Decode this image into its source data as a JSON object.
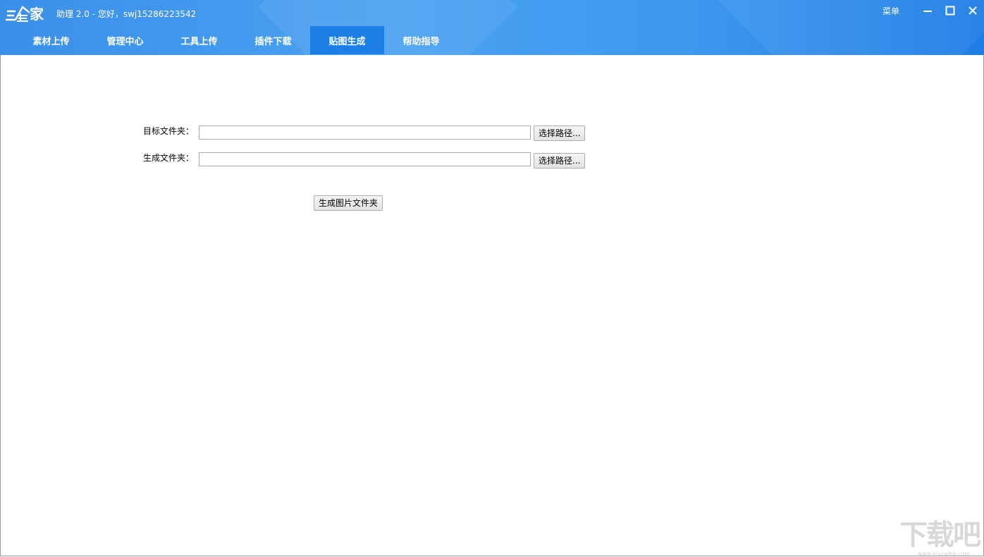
{
  "app": {
    "logo_text": "家",
    "title": "助理 2.0 - 您好，swj15286223542",
    "menu_label": "菜单"
  },
  "tabs": [
    {
      "label": "素材上传"
    },
    {
      "label": "管理中心"
    },
    {
      "label": "工具上传"
    },
    {
      "label": "插件下载"
    },
    {
      "label": "贴图生成",
      "active": true
    },
    {
      "label": "帮助指导"
    }
  ],
  "form": {
    "target_label": "目标文件夹：",
    "target_value": "",
    "output_label": "生成文件夹：",
    "output_value": "",
    "browse_label": "选择路径...",
    "generate_label": "生成图片文件夹"
  },
  "watermark": {
    "text": "下载吧",
    "site": "www.xiazaiba.com"
  },
  "colors": {
    "titlebar": "#3d98ee",
    "active_tab": "#1b7fe6"
  }
}
